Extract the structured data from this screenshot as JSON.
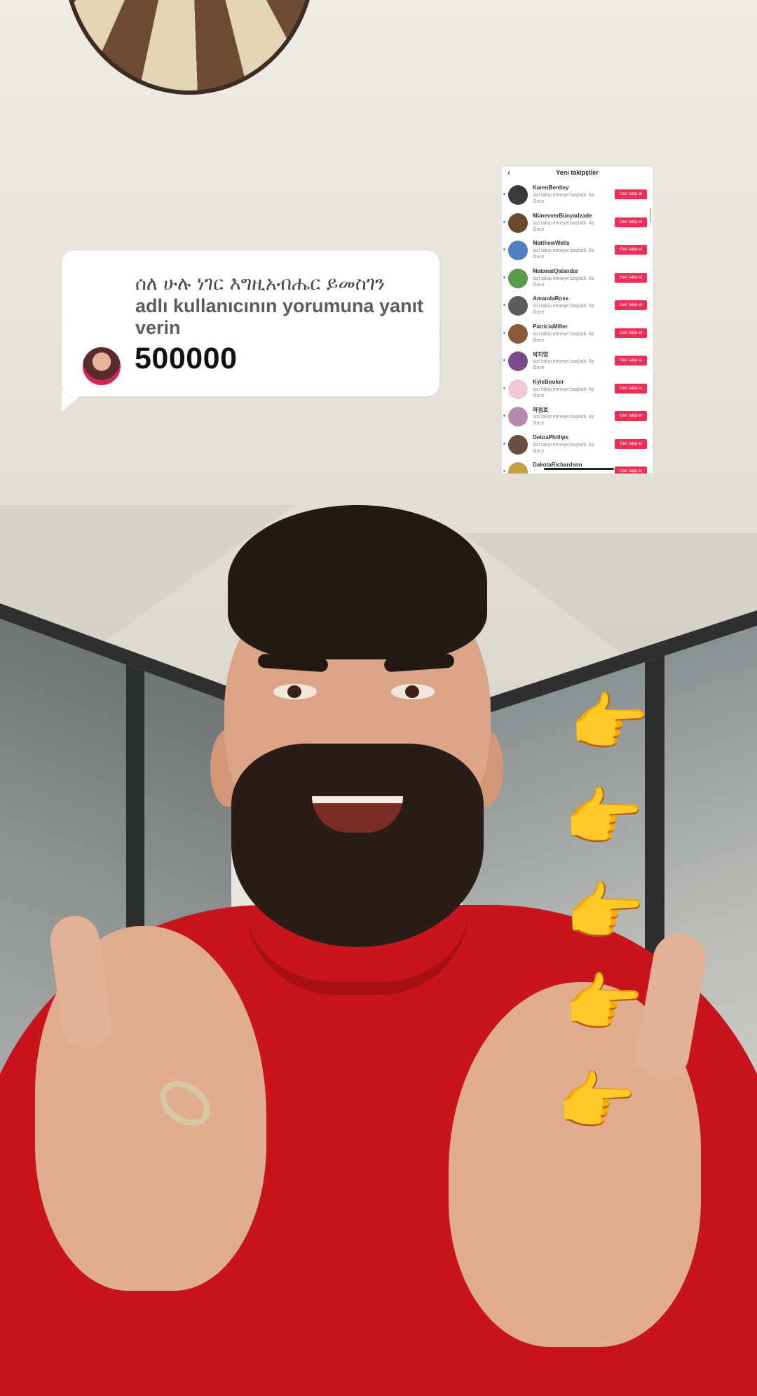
{
  "comment": {
    "username": "ሰለ ሁሉ ነገር እግዚአብሔር ይመስገን",
    "reply_text": "adlı kullanıcının yorumuna yanıt verin",
    "body": "500000"
  },
  "followers_panel": {
    "back_icon": "‹",
    "title": "Yeni takipçiler",
    "items": [
      {
        "name": "KarenBentley",
        "subtitle": "sizi takip etmeye başladı. Az Önce",
        "button": "Geri takip et",
        "avatar_color": "#3b3b3b"
      },
      {
        "name": "MünevverBünyadzade",
        "subtitle": "sizi takip etmeye başladı. Az Önce",
        "button": "Geri takip et",
        "avatar_color": "#6b4a2c"
      },
      {
        "name": "MatthewWells",
        "subtitle": "sizi takip etmeye başladı. Az Önce",
        "button": "Geri takip et",
        "avatar_color": "#4f7fc4"
      },
      {
        "name": "MatanatQalandar",
        "subtitle": "sizi takip etmeye başladı. Az Önce",
        "button": "Geri takip et",
        "avatar_color": "#5a9a4a"
      },
      {
        "name": "AmandaRoss",
        "subtitle": "sizi takip etmeye başladı. Az Önce",
        "button": "Geri takip et",
        "avatar_color": "#5a5f5a"
      },
      {
        "name": "PatriciaMiller",
        "subtitle": "sizi takip etmeye başladı. Az Önce",
        "button": "Geri takip et",
        "avatar_color": "#8a5a3a"
      },
      {
        "name": "박지영",
        "subtitle": "sizi takip etmeye başladı. Az Önce",
        "button": "Geri takip et",
        "avatar_color": "#7a4a8a"
      },
      {
        "name": "KyleBooker",
        "subtitle": "sizi takip etmeye başladı. Az Önce",
        "button": "Geri takip et",
        "avatar_color": "#f1c8d8"
      },
      {
        "name": "하정호",
        "subtitle": "sizi takip etmeye başladı. Az Önce",
        "button": "Geri takip et",
        "avatar_color": "#b98ab0"
      },
      {
        "name": "DebraPhillips",
        "subtitle": "sizi takip etmeye başladı. Az Önce",
        "button": "Geri takip et",
        "avatar_color": "#6a5040"
      },
      {
        "name": "DakotaRichardson",
        "subtitle": "",
        "button": "Geri takip et",
        "avatar_color": "#c9a040"
      }
    ]
  },
  "pointing_emoji": "👉",
  "colors": {
    "accent_button": "#ee2c56",
    "shirt": "#c8151c",
    "emoji": "#e04553"
  }
}
